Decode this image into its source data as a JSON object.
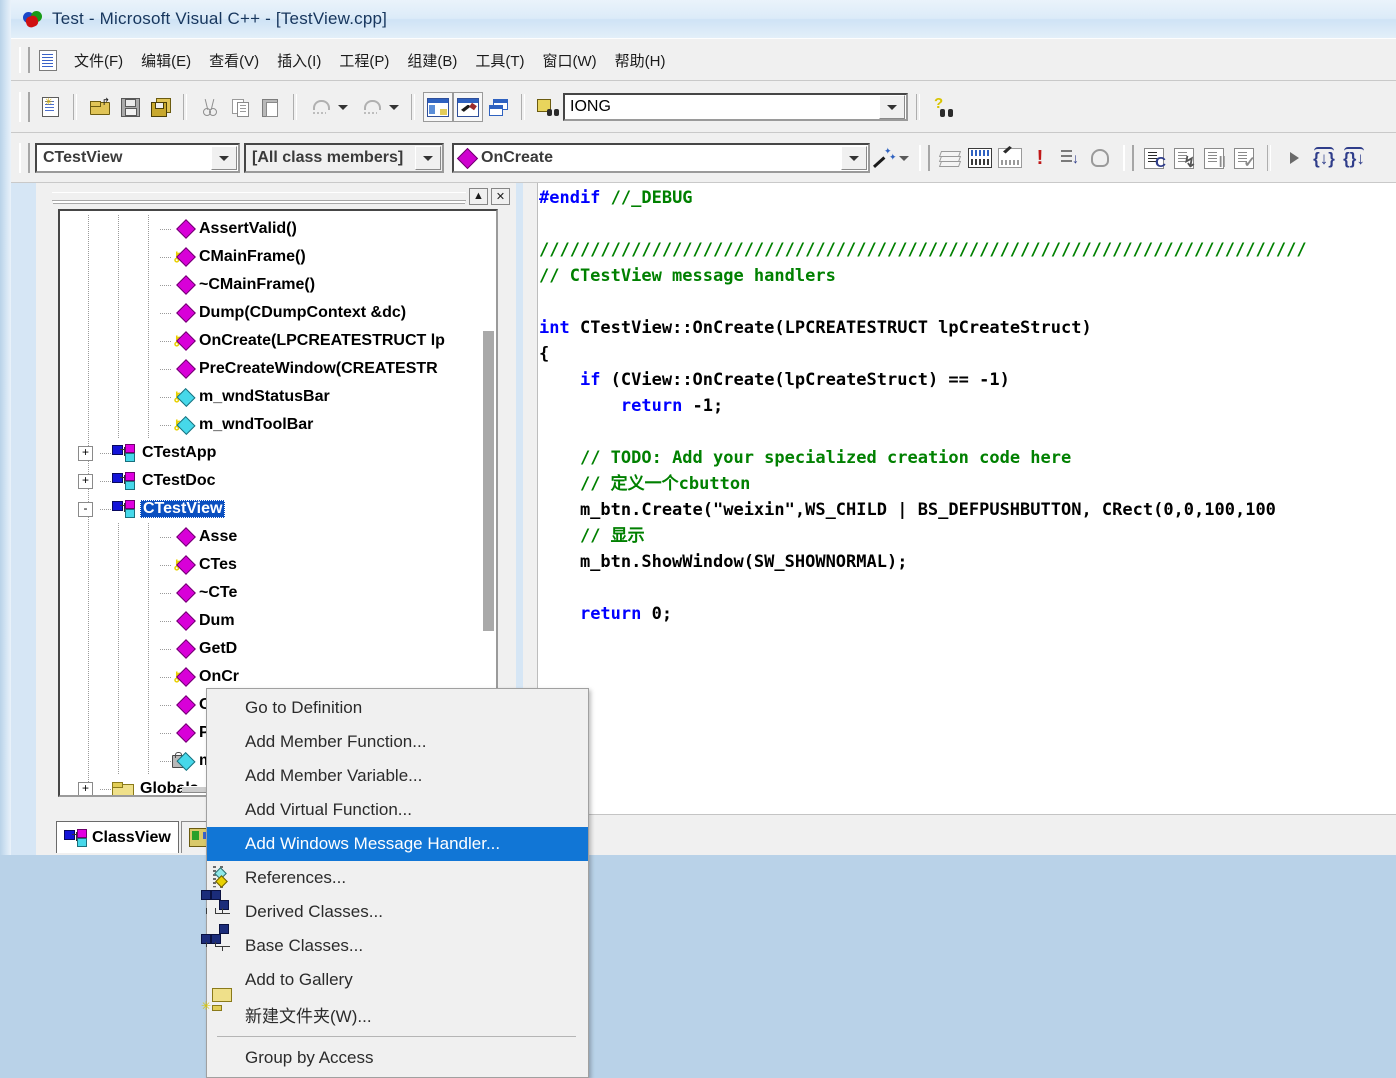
{
  "window": {
    "title": "Test - Microsoft Visual C++ - [TestView.cpp]",
    "app_icon": "vcpp-icon"
  },
  "menubar": {
    "doc_icon": "document-icon",
    "items": [
      {
        "label": "文件(F)",
        "accel": "F"
      },
      {
        "label": "编辑(E)",
        "accel": "E"
      },
      {
        "label": "查看(V)",
        "accel": "V"
      },
      {
        "label": "插入(I)",
        "accel": "I"
      },
      {
        "label": "工程(P)",
        "accel": "P"
      },
      {
        "label": "组建(B)",
        "accel": "B"
      },
      {
        "label": "工具(T)",
        "accel": "T"
      },
      {
        "label": "窗口(W)",
        "accel": "W"
      },
      {
        "label": "帮助(H)",
        "accel": "H"
      }
    ]
  },
  "toolbar_standard": {
    "buttons": [
      "new-document-icon",
      "open-file-icon",
      "save-icon",
      "save-all-icon",
      "cut-icon",
      "copy-icon",
      "paste-icon",
      "undo-icon",
      "undo-dropdown-icon",
      "redo-icon",
      "redo-dropdown-icon",
      "workspace-icon",
      "output-icon",
      "window-list-icon",
      "find-in-files-icon"
    ],
    "find_combo": {
      "value": "IONG",
      "placeholder": "",
      "dropdown_icon": "chevron-down-icon"
    },
    "help_button": "find-help-icon"
  },
  "wizardbar": {
    "class_combo": {
      "value": "CTestView",
      "dropdown_icon": "chevron-down-icon"
    },
    "filter_combo": {
      "value": "[All class members]",
      "dropdown_icon": "chevron-down-icon"
    },
    "member_combo": {
      "value": "OnCreate",
      "icon": "member-diamond-icon",
      "dropdown_icon": "chevron-down-icon"
    },
    "wizard_button": {
      "icon": "magic-wand-icon",
      "dropdown_icon": "chevron-down-icon"
    },
    "buttons": [
      "books-icon",
      "search-keyboard-icon",
      "clear-keyboard-icon",
      "error-icon",
      "bookmark-next-icon",
      "hand-icon",
      "compile-icon",
      "build-icon",
      "stop-build-icon",
      "execute-icon",
      "go-icon",
      "insert-breakpoint-icon",
      "remove-breakpoint-icon"
    ]
  },
  "workspace": {
    "title_buttons": [
      "maximize-icon",
      "close-icon"
    ],
    "tree": [
      {
        "label": "AssertValid()",
        "indent": 3,
        "icon": "member-function",
        "access": "public",
        "expander": ""
      },
      {
        "label": "CMainFrame()",
        "indent": 3,
        "icon": "member-function",
        "access": "protected",
        "expander": ""
      },
      {
        "label": "~CMainFrame()",
        "indent": 3,
        "icon": "member-function",
        "access": "public",
        "expander": ""
      },
      {
        "label": "Dump(CDumpContext &dc)",
        "indent": 3,
        "icon": "member-function",
        "access": "public",
        "expander": ""
      },
      {
        "label": "OnCreate(LPCREATESTRUCT lp",
        "indent": 3,
        "icon": "member-function",
        "access": "protected",
        "expander": ""
      },
      {
        "label": "PreCreateWindow(CREATESTR",
        "indent": 3,
        "icon": "member-function",
        "access": "public",
        "expander": ""
      },
      {
        "label": "m_wndStatusBar",
        "indent": 3,
        "icon": "member-variable",
        "access": "protected",
        "expander": ""
      },
      {
        "label": "m_wndToolBar",
        "indent": 3,
        "icon": "member-variable",
        "access": "protected",
        "expander": ""
      },
      {
        "label": "CTestApp",
        "indent": 1,
        "icon": "class",
        "access": "",
        "expander": "+"
      },
      {
        "label": "CTestDoc",
        "indent": 1,
        "icon": "class",
        "access": "",
        "expander": "+"
      },
      {
        "label": "CTestView",
        "indent": 1,
        "icon": "class",
        "access": "",
        "expander": "-",
        "selected": true
      },
      {
        "label": "Asse",
        "indent": 3,
        "icon": "member-function",
        "access": "public",
        "expander": ""
      },
      {
        "label": "CTes",
        "indent": 3,
        "icon": "member-function",
        "access": "protected",
        "expander": ""
      },
      {
        "label": "~CTe",
        "indent": 3,
        "icon": "member-function",
        "access": "public",
        "expander": ""
      },
      {
        "label": "Dum",
        "indent": 3,
        "icon": "member-function",
        "access": "public",
        "expander": ""
      },
      {
        "label": "GetD",
        "indent": 3,
        "icon": "member-function",
        "access": "public",
        "expander": ""
      },
      {
        "label": "OnCr",
        "indent": 3,
        "icon": "member-function",
        "access": "protected",
        "expander": ""
      },
      {
        "label": "OnDr",
        "indent": 3,
        "icon": "member-function",
        "access": "public",
        "expander": ""
      },
      {
        "label": "PreC",
        "indent": 3,
        "icon": "member-function",
        "access": "public",
        "expander": ""
      },
      {
        "label": "m_bt",
        "indent": 3,
        "icon": "member-variable",
        "access": "private",
        "expander": ""
      },
      {
        "label": "Globals",
        "indent": 1,
        "icon": "folder",
        "access": "",
        "expander": "+"
      }
    ],
    "tabs": [
      {
        "label": "ClassView",
        "icon": "class-view-icon",
        "active": true
      },
      {
        "label": "",
        "icon": "resource-view-icon",
        "active": false
      }
    ]
  },
  "context_menu": {
    "items": [
      {
        "label": "Go to Definition",
        "icon": "",
        "accel_index": 0,
        "highlighted": false
      },
      {
        "label": "Add Member Function...",
        "icon": "",
        "accel_index": 4,
        "highlighted": false
      },
      {
        "label": "Add Member Variable...",
        "icon": "",
        "accel_index": 11,
        "highlighted": false
      },
      {
        "label": "Add Virtual Function...",
        "icon": "",
        "accel_index": 12,
        "highlighted": false
      },
      {
        "label": "Add Windows Message Handler...",
        "icon": "",
        "accel_index": 0,
        "highlighted": true
      },
      {
        "label": "References...",
        "icon": "references-icon",
        "accel_index": 2,
        "highlighted": false
      },
      {
        "label": "Derived Classes...",
        "icon": "derived-classes-icon",
        "accel_index": 3,
        "highlighted": false
      },
      {
        "label": "Base Classes...",
        "icon": "base-classes-icon",
        "accel_index": 0,
        "highlighted": false
      },
      {
        "label": "Add to Gallery",
        "icon": "",
        "accel_index": 12,
        "highlighted": false
      },
      {
        "label": "新建文件夹(W)...",
        "icon": "new-folder-icon",
        "accel_index": -1,
        "highlighted": false
      },
      {
        "separator": true
      },
      {
        "label": "Group by Access",
        "icon": "",
        "accel_index": 13,
        "highlighted": false
      }
    ],
    "highlight_color": "#1176d6"
  },
  "editor": {
    "filename": "TestView.cpp",
    "lines": [
      {
        "text": "#endif //_DEBUG",
        "spans": [
          {
            "t": "#endif ",
            "c": "k"
          },
          {
            "t": "//_DEBUG",
            "c": "c"
          }
        ]
      },
      {
        "text": ""
      },
      {
        "text": "///////////////////////////////////////////////////////////////////////////",
        "spans": [
          {
            "t": "///////////////////////////////////////////////////////////////////////////",
            "c": "c"
          }
        ]
      },
      {
        "text": "// CTestView message handlers",
        "spans": [
          {
            "t": "// CTestView message handlers",
            "c": "c"
          }
        ]
      },
      {
        "text": ""
      },
      {
        "text": "int CTestView::OnCreate(LPCREATESTRUCT lpCreateStruct)",
        "spans": [
          {
            "t": "int",
            "c": "k"
          },
          {
            "t": " CTestView::OnCreate(LPCREATESTRUCT lpCreateStruct)",
            "c": ""
          }
        ]
      },
      {
        "text": "{",
        "spans": [
          {
            "t": "{",
            "c": ""
          }
        ]
      },
      {
        "text": "    if (CView::OnCreate(lpCreateStruct) == -1)",
        "spans": [
          {
            "t": "    ",
            "c": ""
          },
          {
            "t": "if",
            "c": "k"
          },
          {
            "t": " (CView::OnCreate(lpCreateStruct) == -1)",
            "c": ""
          }
        ]
      },
      {
        "text": "        return -1;",
        "spans": [
          {
            "t": "        ",
            "c": ""
          },
          {
            "t": "return",
            "c": "k"
          },
          {
            "t": " -1;",
            "c": ""
          }
        ]
      },
      {
        "text": ""
      },
      {
        "text": "    // TODO: Add your specialized creation code here",
        "spans": [
          {
            "t": "    ",
            "c": ""
          },
          {
            "t": "// TODO: Add your specialized creation code here",
            "c": "c"
          }
        ]
      },
      {
        "text": "    // 定义一个cbutton",
        "spans": [
          {
            "t": "    ",
            "c": ""
          },
          {
            "t": "// 定义一个cbutton",
            "c": "c"
          }
        ]
      },
      {
        "text": "    m_btn.Create(\"weixin\",WS_CHILD | BS_DEFPUSHBUTTON, CRect(0,0,100,100",
        "spans": [
          {
            "t": "    m_btn.Create(\"weixin\",WS_CHILD | BS_DEFPUSHBUTTON, CRect(0,0,100,100",
            "c": ""
          }
        ]
      },
      {
        "text": "    // 显示",
        "spans": [
          {
            "t": "    ",
            "c": ""
          },
          {
            "t": "// 显示",
            "c": "c"
          }
        ]
      },
      {
        "text": "    m_btn.ShowWindow(SW_SHOWNORMAL);",
        "spans": [
          {
            "t": "    m_btn.ShowWindow(SW_SHOWNORMAL);",
            "c": ""
          }
        ]
      },
      {
        "text": ""
      },
      {
        "text": "    return 0;",
        "spans": [
          {
            "t": "    ",
            "c": ""
          },
          {
            "t": "return",
            "c": "k"
          },
          {
            "t": " 0;",
            "c": ""
          }
        ]
      }
    ],
    "colors": {
      "comment": "#008000",
      "keyword": "#0000ff",
      "text": "#000000"
    }
  }
}
